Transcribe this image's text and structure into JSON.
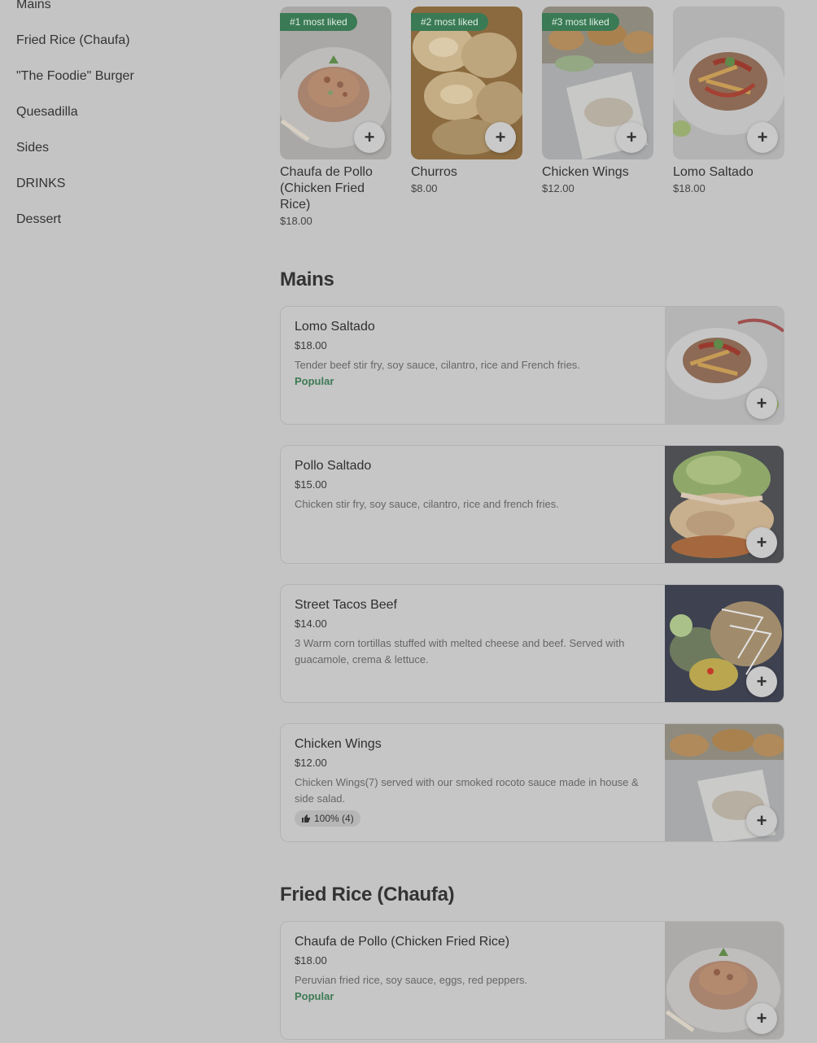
{
  "sidebar": {
    "items": [
      {
        "label": "Mains"
      },
      {
        "label": "Fried Rice (Chaufa)"
      },
      {
        "label": "\"The Foodie\" Burger"
      },
      {
        "label": "Quesadilla"
      },
      {
        "label": "Sides"
      },
      {
        "label": "DRINKS"
      },
      {
        "label": "Dessert"
      }
    ]
  },
  "popular": [
    {
      "badge": "#1 most liked",
      "name": "Chaufa de Pollo (Chicken Fried Rice)",
      "price": "$18.00"
    },
    {
      "badge": "#2 most liked",
      "name": "Churros",
      "price": "$8.00"
    },
    {
      "badge": "#3 most liked",
      "name": "Chicken Wings",
      "price": "$12.00"
    },
    {
      "badge": "",
      "name": "Lomo Saltado",
      "price": "$18.00"
    }
  ],
  "add_symbol": "+",
  "sections": {
    "mains": {
      "title": "Mains",
      "items": [
        {
          "name": "Lomo Saltado",
          "price": "$18.00",
          "desc": "Tender beef stir fry, soy sauce, cilantro, rice and French fries.",
          "tag": "Popular"
        },
        {
          "name": "Pollo Saltado",
          "price": "$15.00",
          "desc": "Chicken stir fry, soy sauce, cilantro, rice and french fries."
        },
        {
          "name": "Street Tacos Beef",
          "price": "$14.00",
          "desc": "3 Warm corn tortillas stuffed with melted cheese and beef. Served with guacamole, crema & lettuce."
        },
        {
          "name": "Chicken Wings",
          "price": "$12.00",
          "desc": "Chicken Wings(7) served with our smoked rocoto sauce made in house & side salad.",
          "rating": "100% (4)"
        }
      ]
    },
    "fried_rice": {
      "title": "Fried Rice (Chaufa)",
      "items": [
        {
          "name": "Chaufa de Pollo (Chicken Fried Rice)",
          "price": "$18.00",
          "desc": "Peruvian fried rice, soy sauce, eggs, red peppers.",
          "tag": "Popular"
        }
      ]
    }
  },
  "icons": {
    "add": "plus-icon",
    "rating": "thumbs-up-icon"
  },
  "colors": {
    "accent": "#3a7a55",
    "tag": "#3e7a55",
    "overlay_bg": "#c4c4c4"
  }
}
